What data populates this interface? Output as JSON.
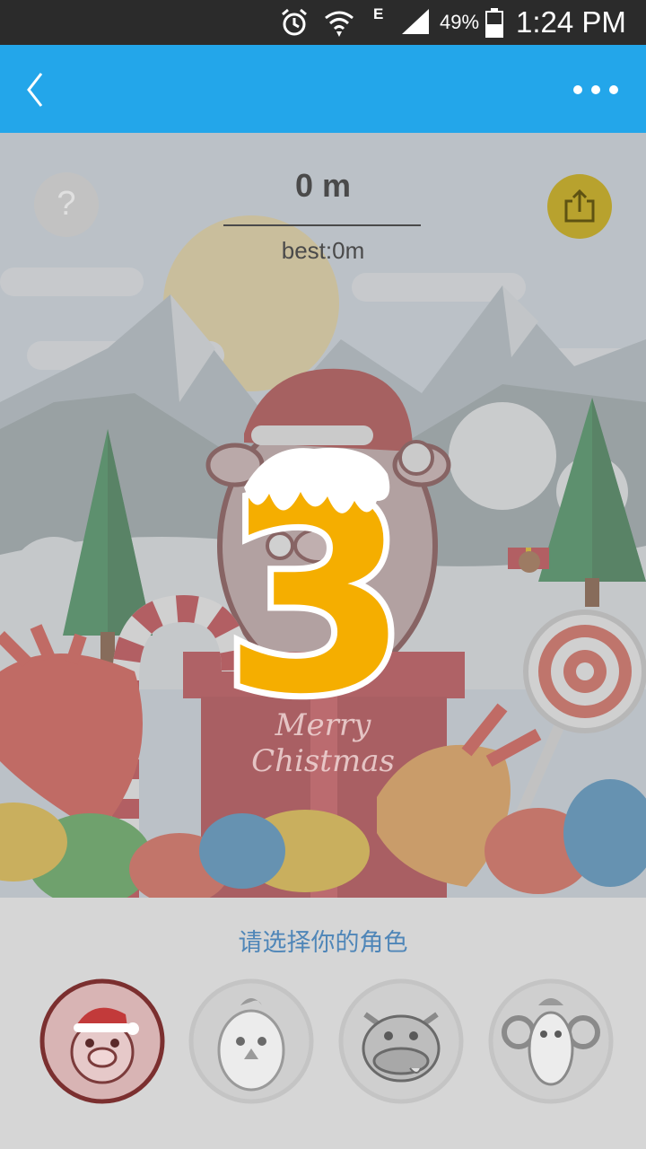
{
  "status_bar": {
    "network": "E",
    "battery": "49%",
    "time": "1:24 PM",
    "icons": [
      "alarm-icon",
      "wifi-icon",
      "signal-icon",
      "battery-icon"
    ]
  },
  "app_bar": {
    "back_icon": "chevron-left-icon",
    "more_icon": "more-dots-icon",
    "color": "#23a6ea"
  },
  "game": {
    "distance": "0 m",
    "best": "best:0m",
    "help_label": "?",
    "countdown": "3",
    "banner_line1": "Merry",
    "banner_line2": "Chistmas",
    "accent": "#f5ae00"
  },
  "picker": {
    "title": "请选择你的角色",
    "characters": [
      {
        "name": "pig",
        "selected": true
      },
      {
        "name": "chicken",
        "selected": false
      },
      {
        "name": "cow",
        "selected": false
      },
      {
        "name": "sheep",
        "selected": false
      }
    ]
  }
}
